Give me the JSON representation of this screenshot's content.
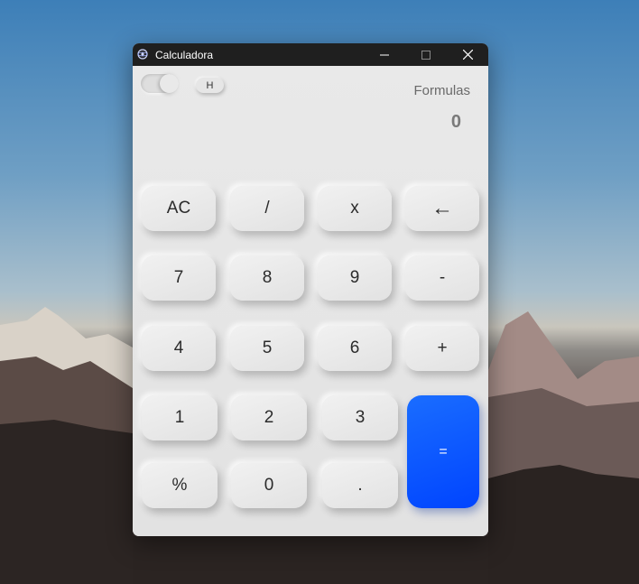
{
  "window": {
    "title": "Calculadora"
  },
  "header": {
    "toggle": "",
    "history_label": "H",
    "formulas_label": "Formulas",
    "display_value": "0"
  },
  "keys": {
    "ac": "AC",
    "divide": "/",
    "multiply": "x",
    "backspace": "←",
    "seven": "7",
    "eight": "8",
    "nine": "9",
    "minus": "-",
    "four": "4",
    "five": "5",
    "six": "6",
    "plus": "+",
    "one": "1",
    "two": "2",
    "three": "3",
    "equals": "=",
    "percent": "%",
    "zero": "0",
    "dot": "."
  },
  "colors": {
    "accent": "#0a55ff",
    "surface": "#e6e6e6",
    "titlebar": "#1f1f1f"
  }
}
